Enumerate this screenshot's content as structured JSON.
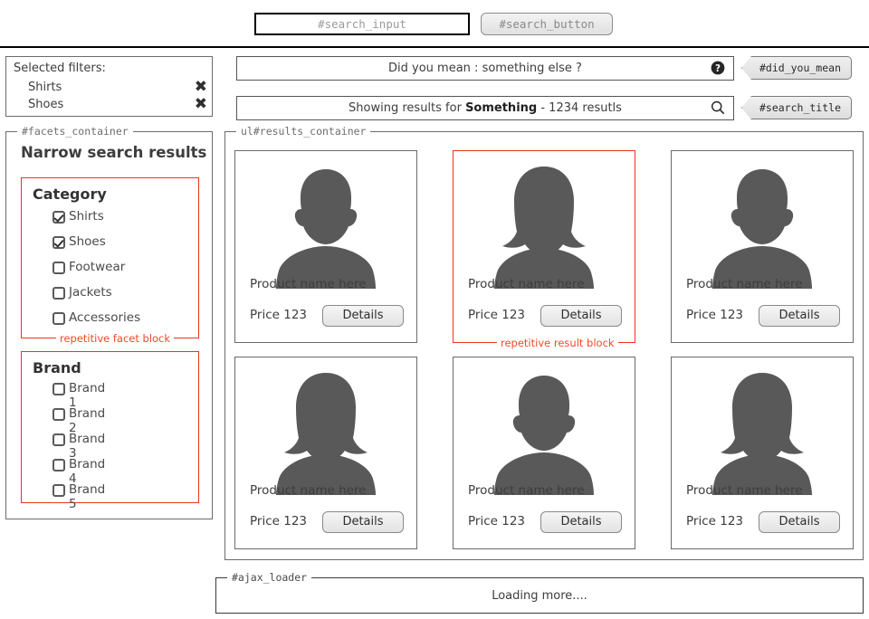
{
  "header": {
    "search_input_value": "#search_input",
    "search_button_label": "#search_button"
  },
  "selected_filters": {
    "title": "Selected filters:",
    "items": [
      {
        "label": "Shirts",
        "remove_icon": "close-x-icon"
      },
      {
        "label": "Shoes",
        "remove_icon": "close-x-icon"
      }
    ]
  },
  "suggestion_bar": {
    "text_prefix": "Did you mean : something else ?",
    "icon": "help-question-icon",
    "tag_label": "#did_you_mean"
  },
  "results_bar": {
    "text_before": "Showing results for ",
    "text_bold": "Something",
    "text_after": " - 1234 resutls",
    "icon": "search-magnifier-icon",
    "tag_label": "#search_title"
  },
  "facets": {
    "legend": "#facets_container",
    "heading": "Narrow search results",
    "blocks": [
      {
        "title": "Category",
        "note": "repetitive facet block",
        "options": [
          {
            "label": "Shirts",
            "checked": true
          },
          {
            "label": "Shoes",
            "checked": true
          },
          {
            "label": "Footwear",
            "checked": false
          },
          {
            "label": "Jackets",
            "checked": false
          },
          {
            "label": "Accessories",
            "checked": false
          }
        ]
      },
      {
        "title": "Brand",
        "note": "",
        "options": [
          {
            "label": "Brand 1",
            "checked": false
          },
          {
            "label": "Brand 2",
            "checked": false
          },
          {
            "label": "Brand 3",
            "checked": false
          },
          {
            "label": "Brand 4",
            "checked": false
          },
          {
            "label": "Brand 5",
            "checked": false
          }
        ]
      }
    ]
  },
  "results": {
    "legend": "ul#results_container",
    "highlight_note": "repetitive result block",
    "cards": [
      {
        "name": "Product name here",
        "price": "Price 123",
        "button": "Details",
        "avatar": "male-silhouette-icon",
        "highlight": false
      },
      {
        "name": "Product name here",
        "price": "Price 123",
        "button": "Details",
        "avatar": "female-silhouette-icon",
        "highlight": true
      },
      {
        "name": "Product name here",
        "price": "Price 123",
        "button": "Details",
        "avatar": "male-silhouette-icon",
        "highlight": false
      },
      {
        "name": "Product name here",
        "price": "Price 123",
        "button": "Details",
        "avatar": "female-silhouette-icon",
        "highlight": false
      },
      {
        "name": "Product name here",
        "price": "Price 123",
        "button": "Details",
        "avatar": "male-silhouette-icon",
        "highlight": false
      },
      {
        "name": "Product name here",
        "price": "Price 123",
        "button": "Details",
        "avatar": "female-silhouette-icon",
        "highlight": false
      }
    ]
  },
  "ajax_loader": {
    "legend": "#ajax_loader",
    "text": "Loading more...."
  },
  "colors": {
    "highlight": "#ee3322",
    "note_text": "#f04a2a",
    "silhouette": "#595959",
    "border": "#6b6b6b"
  }
}
